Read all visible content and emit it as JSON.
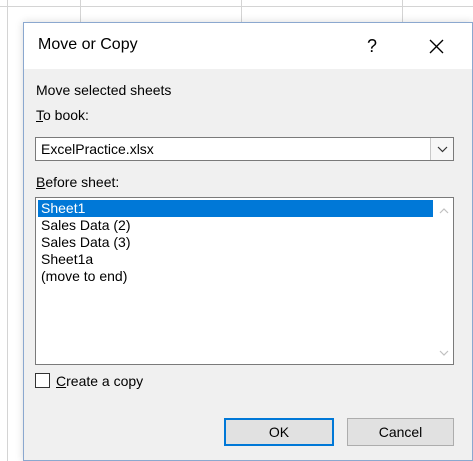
{
  "dialog": {
    "title": "Move or Copy",
    "help_label": "?",
    "close_icon": "close-icon",
    "move_selected_label": "Move selected sheets",
    "to_book_label": {
      "mnemonic": "T",
      "rest": "o book:"
    },
    "to_book_value": "ExcelPractice.xlsx",
    "before_sheet_label": {
      "mnemonic": "B",
      "rest": "efore sheet:"
    },
    "sheets": [
      "Sheet1",
      "Sales Data (2)",
      "Sales Data (3)",
      "Sheet1a",
      "(move to end)"
    ],
    "selected_sheet": "Sheet1",
    "create_copy_label": {
      "mnemonic": "C",
      "rest": "reate a copy"
    },
    "create_copy_checked": false,
    "ok_label": "OK",
    "cancel_label": "Cancel"
  },
  "colors": {
    "accent": "#0078d7",
    "dialog_bg": "#f0f0f0",
    "border": "#8ba8cf"
  }
}
